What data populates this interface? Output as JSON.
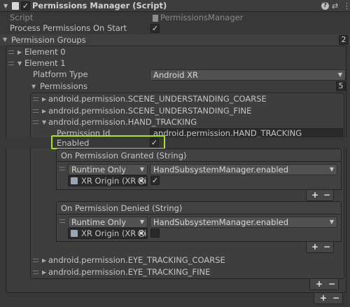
{
  "header": {
    "title": "Permissions Manager (Script)",
    "enabled_check": "✓",
    "help_icon": "?",
    "settings_icon": "⇄",
    "menu_icon": "⋮"
  },
  "script_row": {
    "label": "Script",
    "value": "PermissionsManager"
  },
  "process_row": {
    "label": "Process Permissions On Start",
    "checked": "✓"
  },
  "groups": {
    "label": "Permission Groups",
    "size": "2"
  },
  "element0": {
    "label": "Element 0"
  },
  "element1": {
    "label": "Element 1",
    "platform_label": "Platform Type",
    "platform_value": "Android XR",
    "permissions_label": "Permissions",
    "permissions_size": "5"
  },
  "permissions": {
    "p0": "android.permission.SCENE_UNDERSTANDING_COARSE",
    "p1": "android.permission.SCENE_UNDERSTANDING_FINE",
    "p2": "android.permission.HAND_TRACKING",
    "p3": "android.permission.EYE_TRACKING_COARSE",
    "p4": "android.permission.EYE_TRACKING_FINE"
  },
  "hand_tracking": {
    "permission_id_label": "Permission Id",
    "permission_id_value": "android.permission.HAND_TRACKING",
    "enabled_label": "Enabled",
    "enabled_check": "✓"
  },
  "granted_event": {
    "title": "On Permission Granted (String)",
    "mode": "Runtime Only",
    "function": "HandSubsystemManager.enabled",
    "target": "XR Origin (XR Rig) (H",
    "arg_check": "✓"
  },
  "denied_event": {
    "title": "On Permission Denied (String)",
    "mode": "Runtime Only",
    "function": "HandSubsystemManager.enabled",
    "target": "XR Origin (XR Rig) (H",
    "arg_check": ""
  },
  "buttons": {
    "plus": "+",
    "minus": "−"
  },
  "colors": {
    "highlight": "#a8e22a",
    "background": "#383838"
  }
}
